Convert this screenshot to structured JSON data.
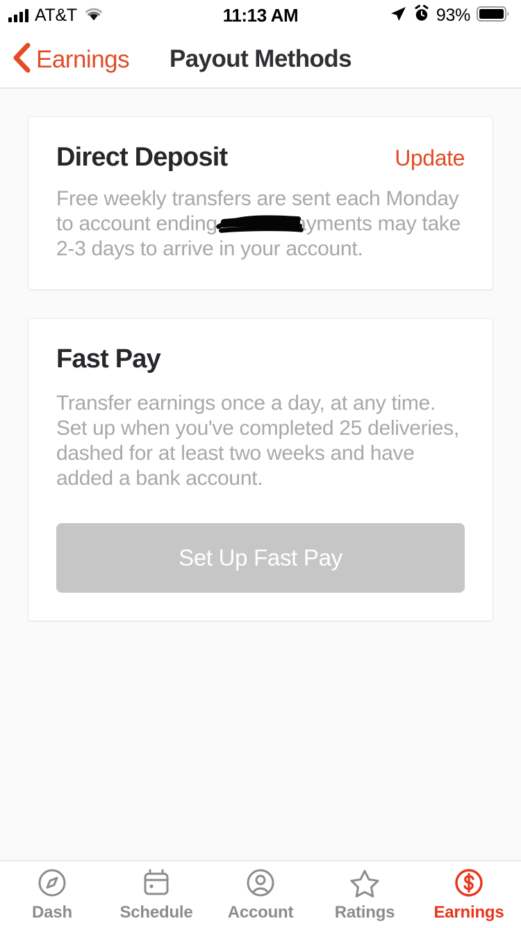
{
  "status_bar": {
    "carrier": "AT&T",
    "signal_icon": "cellular-signal-icon",
    "wifi_icon": "wifi-icon",
    "time": "11:13 AM",
    "location_icon": "location-arrow-icon",
    "alarm_icon": "alarm-clock-icon",
    "battery_percent": "93%",
    "battery_icon": "battery-full-icon"
  },
  "nav": {
    "back_icon": "chevron-left-icon",
    "back_label": "Earnings",
    "title": "Payout Methods",
    "accent_color": "#e24b26"
  },
  "cards": [
    {
      "id": "direct-deposit",
      "title": "Direct Deposit",
      "action_label": "Update",
      "body_before_redaction": "Free weekly transfers are sent each Monday to account ending",
      "redacted_value": "████",
      "body_after_redaction": "Payments may take 2-3 days to arrive in your account."
    },
    {
      "id": "fast-pay",
      "title": "Fast Pay",
      "body": "Transfer earnings once a day, at any time. Set up when you've completed 25 deliveries, dashed for at least two weeks and have added a bank account.",
      "button_label": "Set Up Fast Pay",
      "button_disabled": true
    }
  ],
  "tab_bar": {
    "items": [
      {
        "label": "Dash",
        "icon": "compass-icon",
        "active": false
      },
      {
        "label": "Schedule",
        "icon": "calendar-icon",
        "active": false
      },
      {
        "label": "Account",
        "icon": "user-circle-icon",
        "active": false
      },
      {
        "label": "Ratings",
        "icon": "star-outline-icon",
        "active": false
      },
      {
        "label": "Earnings",
        "icon": "dollar-circle-icon",
        "active": true
      }
    ],
    "active_color": "#e8351b",
    "inactive_color": "#8c8c8c"
  }
}
